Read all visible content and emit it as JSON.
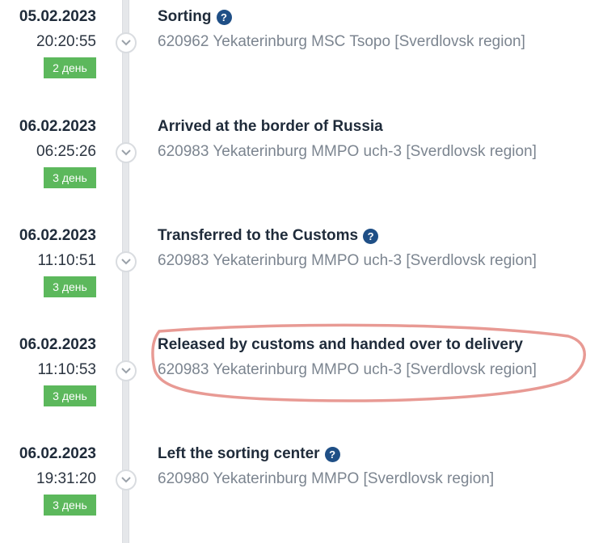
{
  "events": [
    {
      "date": "05.02.2023",
      "time": "20:20:55",
      "badge": "2 день",
      "title": "Sorting",
      "has_help": true,
      "location": "620962 Yekaterinburg MSC Tsopo [Sverdlovsk region]"
    },
    {
      "date": "06.02.2023",
      "time": "06:25:26",
      "badge": "3 день",
      "title": "Arrived at the border of Russia",
      "has_help": false,
      "location": "620983 Yekaterinburg MMPO uch-3 [Sverdlovsk region]"
    },
    {
      "date": "06.02.2023",
      "time": "11:10:51",
      "badge": "3 день",
      "title": "Transferred to the Customs",
      "has_help": true,
      "location": "620983 Yekaterinburg MMPO uch-3 [Sverdlovsk region]"
    },
    {
      "date": "06.02.2023",
      "time": "11:10:53",
      "badge": "3 день",
      "title": "Released by customs and handed over to delivery",
      "has_help": false,
      "location": "620983 Yekaterinburg MMPO uch-3 [Sverdlovsk region]",
      "highlighted": true
    },
    {
      "date": "06.02.2023",
      "time": "19:31:20",
      "badge": "3 день",
      "title": "Left the sorting center",
      "has_help": true,
      "location": "620980 Yekaterinburg MMPO [Sverdlovsk region]"
    }
  ],
  "icons": {
    "node": "chevron-down-icon",
    "help": "question-circle-icon",
    "help_glyph": "?"
  },
  "colors": {
    "badge": "#5cb85c",
    "help": "#1f4f86",
    "highlight": "#e89a94"
  }
}
